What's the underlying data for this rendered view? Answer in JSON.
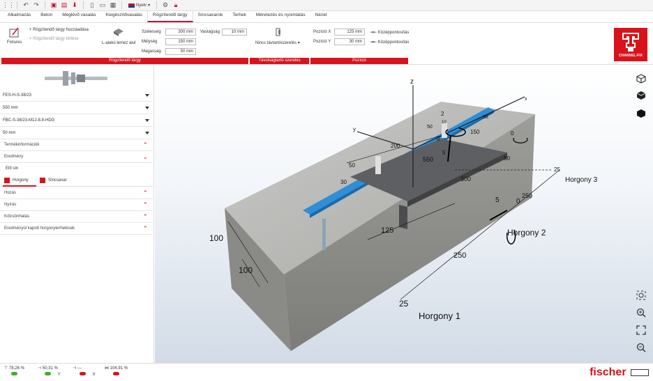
{
  "toolbar": {
    "language_label": "Nyelv"
  },
  "menu": {
    "tabs": [
      {
        "label": "Alkalmazás"
      },
      {
        "label": "Beton"
      },
      {
        "label": "Meglévő vasalás"
      },
      {
        "label": "Kiegészítővasalás"
      },
      {
        "label": "Rögzítendő tárgy"
      },
      {
        "label": "Síncsavarok"
      },
      {
        "label": "Terhek"
      },
      {
        "label": "Méretezés és nyomtatás"
      },
      {
        "label": "Nézet"
      }
    ],
    "active_tab": "Rögzítendő tárgy"
  },
  "ribbon": {
    "fixtures_label": "Fixtures",
    "add_fixture": "Rögzítendő tárgy hozzáadása",
    "delete_fixture": "Rögzítendő tárgy törlése",
    "plate_type": "L-alakú lemez alul",
    "width_label": "Szélesség",
    "width_value": "300 mm",
    "depth_label": "Mélység",
    "depth_value": "150 mm",
    "height_label": "Magasság",
    "height_value": "50 mm",
    "thickness_label": "Vastagság",
    "thickness_value": "10 mm",
    "group_fixture": "Rögzítendő tárgy",
    "standoff_label": "Nincs távtartószerelés",
    "group_standoff": "Távolságtartó szerelés",
    "pos_x_label": "Pozíció X",
    "pos_x_value": "125 mm",
    "pos_y_label": "Pozíció Y",
    "pos_y_value": "30 mm",
    "center_label": "Középpontosítás",
    "group_position": "Pozíció",
    "logo_text": "CHANNEL-FIX"
  },
  "left_panel": {
    "dropdowns": [
      "FES-H-S-38/23",
      "550 mm",
      "FBC-S-38/23-M12-8.8-HDG",
      "50 mm"
    ],
    "accordions_top": [
      "Termékinformációk",
      "Eredmény"
    ],
    "section_label": "Elő sín",
    "tabs": [
      "Horgony",
      "Síncsavar"
    ],
    "accordions_bottom": [
      "Húzás",
      "Nyírás",
      "Kölcsönhatás",
      "Eredményül kapott horgonyterhelések"
    ]
  },
  "viewport": {
    "labels": {
      "anchor1": "Horgony 1",
      "anchor2": "Horgony 2",
      "anchor3": "Horgony 3",
      "z": "z",
      "y": "y",
      "x": "x"
    },
    "dimensions": [
      "100",
      "100",
      "25",
      "250",
      "125",
      "300",
      "50",
      "30",
      "200",
      "550",
      "250",
      "25",
      "150",
      "38",
      "50",
      "0",
      "5",
      "2",
      "10",
      "0",
      "5",
      "0",
      "50"
    ]
  },
  "status": [
    {
      "value": "78,26 %",
      "color": "#3fae29",
      "axis": ""
    },
    {
      "value": "50,31 %",
      "color": "#3fae29",
      "axis": "Y"
    },
    {
      "value": "---",
      "color": "#d9131c",
      "axis": "X"
    },
    {
      "value": "104,91 %",
      "color": "#d9131c",
      "axis": ""
    }
  ],
  "brand": "fischer"
}
